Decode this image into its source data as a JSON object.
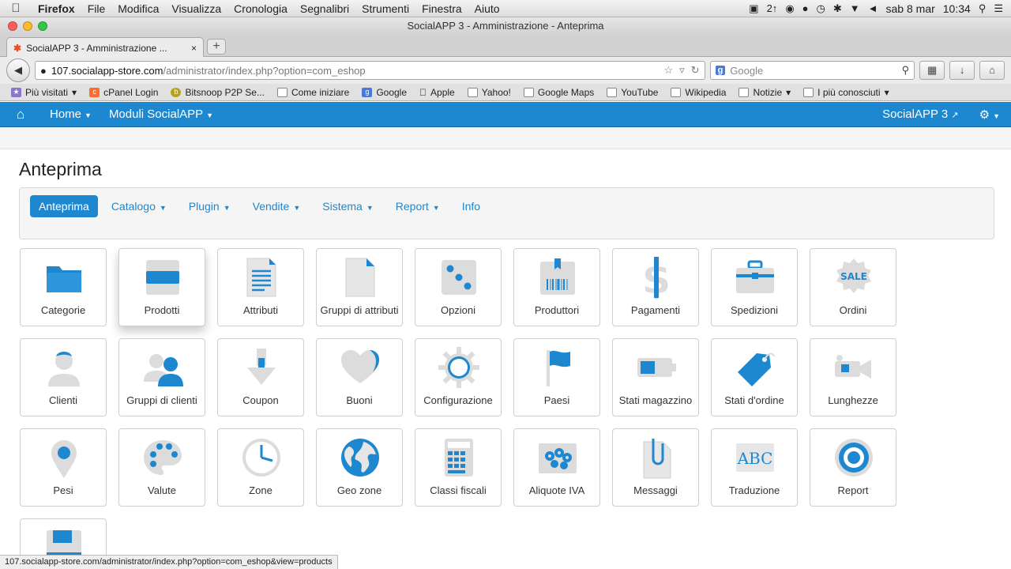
{
  "menubar": {
    "app": "Firefox",
    "items": [
      "File",
      "Modifica",
      "Visualizza",
      "Cronologia",
      "Segnalibri",
      "Strumenti",
      "Finestra",
      "Aiuto"
    ],
    "clock_date": "sab 8 mar",
    "clock_time": "10:34",
    "status_number": "2↑"
  },
  "window": {
    "title": "SocialAPP 3 - Amministrazione - Anteprima"
  },
  "tab": {
    "title": "SocialAPP 3 - Amministrazione ..."
  },
  "urlbar": {
    "host": "107.socialapp-store.com",
    "path": "/administrator/index.php?option=com_eshop"
  },
  "searchbar": {
    "placeholder": "Google"
  },
  "bookmarks": [
    {
      "label": "Più visitati",
      "icon": "star-folder-icon",
      "dropdown": true
    },
    {
      "label": "cPanel Login",
      "icon": "cpanel-icon"
    },
    {
      "label": "Bitsnoop P2P Se...",
      "icon": "bitsnoop-icon"
    },
    {
      "label": "Come iniziare",
      "icon": "page-icon"
    },
    {
      "label": "Google",
      "icon": "google-icon"
    },
    {
      "label": "Apple",
      "icon": "apple-icon"
    },
    {
      "label": "Yahoo!",
      "icon": "page-icon"
    },
    {
      "label": "Google Maps",
      "icon": "page-icon"
    },
    {
      "label": "YouTube",
      "icon": "page-icon"
    },
    {
      "label": "Wikipedia",
      "icon": "page-icon"
    },
    {
      "label": "Notizie",
      "icon": "folder-icon",
      "dropdown": true
    },
    {
      "label": "I più conosciuti",
      "icon": "folder-icon",
      "dropdown": true
    }
  ],
  "joomla": {
    "home": "Home",
    "modules": "Moduli SocialAPP",
    "site": "SocialAPP 3"
  },
  "page": {
    "title": "Anteprima"
  },
  "nav_tabs": [
    {
      "label": "Anteprima",
      "active": true,
      "dropdown": false
    },
    {
      "label": "Catalogo",
      "dropdown": true
    },
    {
      "label": "Plugin",
      "dropdown": true
    },
    {
      "label": "Vendite",
      "dropdown": true
    },
    {
      "label": "Sistema",
      "dropdown": true
    },
    {
      "label": "Report",
      "dropdown": true
    },
    {
      "label": "Info",
      "dropdown": false
    }
  ],
  "tiles": [
    {
      "label": "Categorie",
      "icon": "folder-icon"
    },
    {
      "label": "Prodotti",
      "icon": "product-box-icon"
    },
    {
      "label": "Attributi",
      "icon": "document-lines-icon"
    },
    {
      "label": "Gruppi di attributi",
      "icon": "blank-document-icon"
    },
    {
      "label": "Opzioni",
      "icon": "dice-icon"
    },
    {
      "label": "Produttori",
      "icon": "barcode-box-icon"
    },
    {
      "label": "Pagamenti",
      "icon": "dollar-icon"
    },
    {
      "label": "Spedizioni",
      "icon": "briefcase-icon"
    },
    {
      "label": "Ordini",
      "icon": "sale-badge-icon"
    },
    {
      "label": "Clienti",
      "icon": "user-icon"
    },
    {
      "label": "Gruppi di clienti",
      "icon": "user-group-icon"
    },
    {
      "label": "Coupon",
      "icon": "arrow-down-icon"
    },
    {
      "label": "Buoni",
      "icon": "heart-icon"
    },
    {
      "label": "Configurazione",
      "icon": "gear-icon"
    },
    {
      "label": "Paesi",
      "icon": "flag-icon"
    },
    {
      "label": "Stati magazzino",
      "icon": "battery-icon"
    },
    {
      "label": "Stati d'ordine",
      "icon": "tag-icon"
    },
    {
      "label": "Lunghezze",
      "icon": "video-camera-icon"
    },
    {
      "label": "Pesi",
      "icon": "map-pin-icon"
    },
    {
      "label": "Valute",
      "icon": "palette-icon"
    },
    {
      "label": "Zone",
      "icon": "clock-icon"
    },
    {
      "label": "Geo zone",
      "icon": "globe-icon"
    },
    {
      "label": "Classi fiscali",
      "icon": "calculator-icon"
    },
    {
      "label": "Aliquote IVA",
      "icon": "flowers-image-icon"
    },
    {
      "label": "Messaggi",
      "icon": "paperclip-document-icon"
    },
    {
      "label": "Traduzione",
      "icon": "abc-text-icon"
    },
    {
      "label": "Report",
      "icon": "target-icon"
    },
    {
      "label": "",
      "icon": "floppy-disk-icon"
    }
  ],
  "status_url": "107.socialapp-store.com/administrator/index.php?option=com_eshop&view=products",
  "colors": {
    "accent": "#1d87d0",
    "icon_gray": "#dcdcdc"
  }
}
